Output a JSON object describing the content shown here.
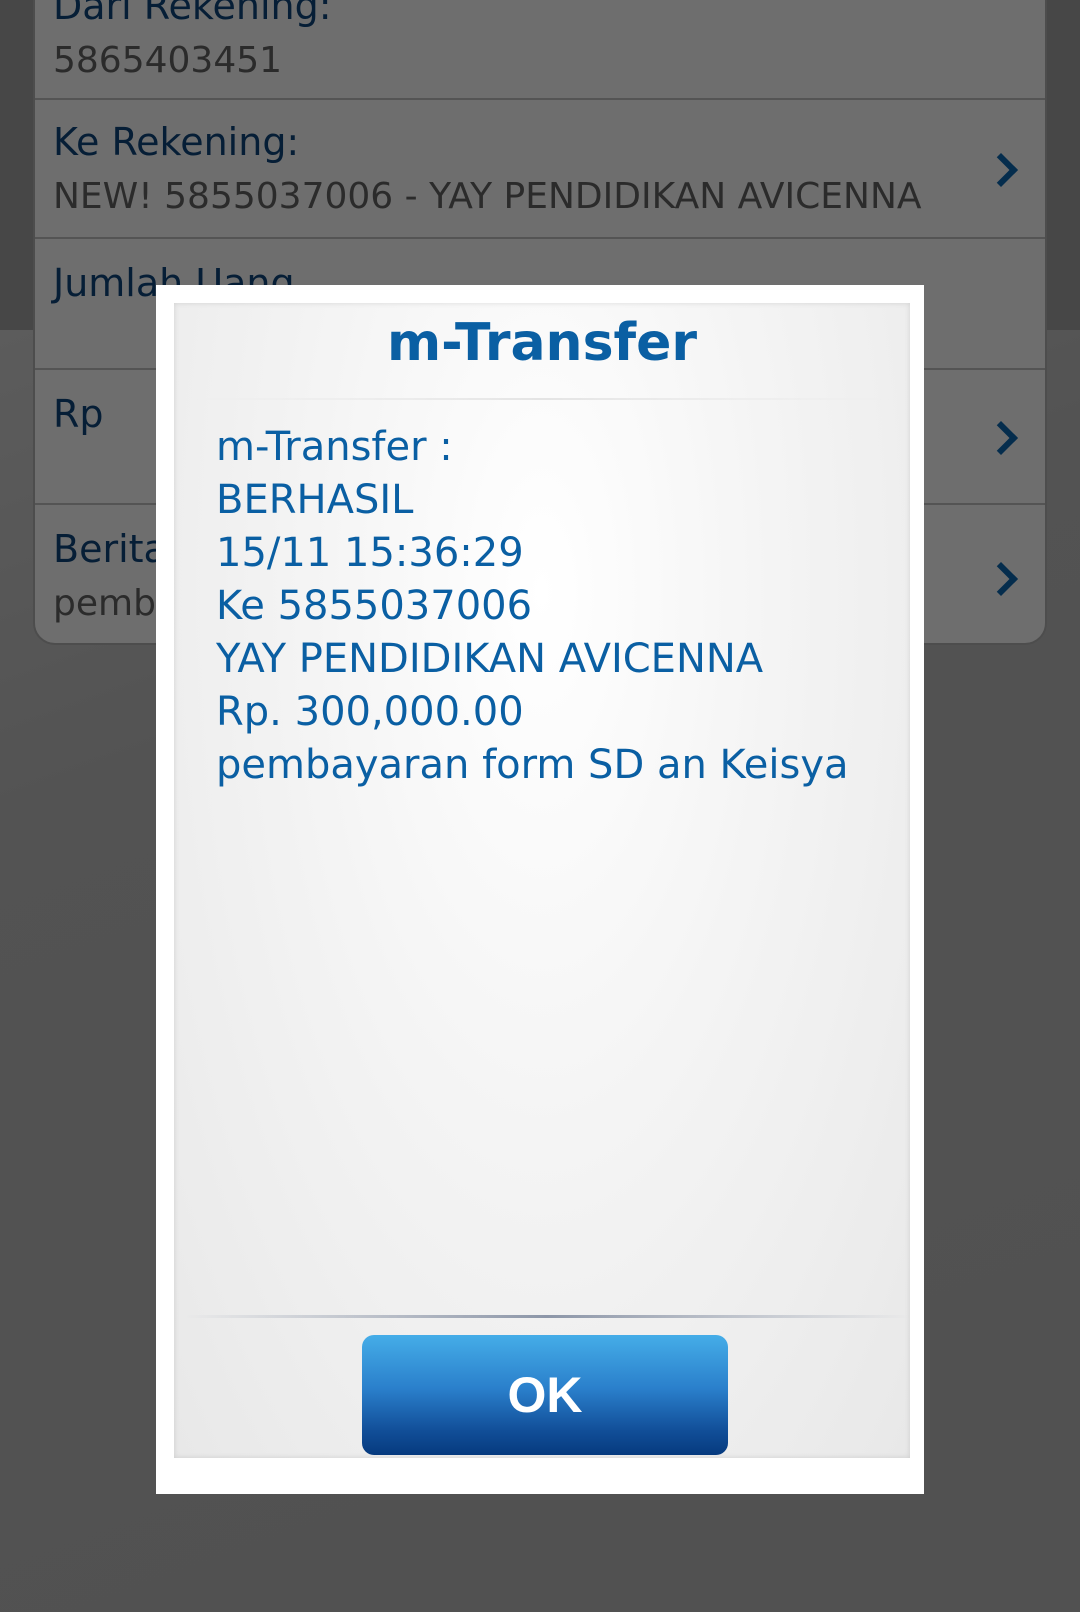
{
  "form": {
    "from_account": {
      "label": "Dari Rekening:",
      "value": "5865403451"
    },
    "to_account": {
      "label": "Ke Rekening:",
      "value": "NEW! 5855037006 - YAY PENDIDIKAN AVICENNA"
    },
    "amount_label": "Jumlah Uang",
    "currency": "Rp",
    "message": {
      "label": "Berita",
      "value": "pemba"
    }
  },
  "dialog": {
    "title": "m-Transfer",
    "lines": [
      "m-Transfer :",
      "BERHASIL",
      "15/11 15:36:29",
      "Ke 5855037006",
      "YAY PENDIDIKAN AVICENNA",
      "Rp. 300,000.00",
      "pembayaran form SD an Keisya"
    ],
    "ok_label": "OK"
  },
  "icons": {
    "row_arrow": "chevron-right-icon"
  },
  "colors": {
    "accent": "#0a5fa3",
    "button_top": "#45ade8",
    "button_bottom": "#063a7e"
  }
}
